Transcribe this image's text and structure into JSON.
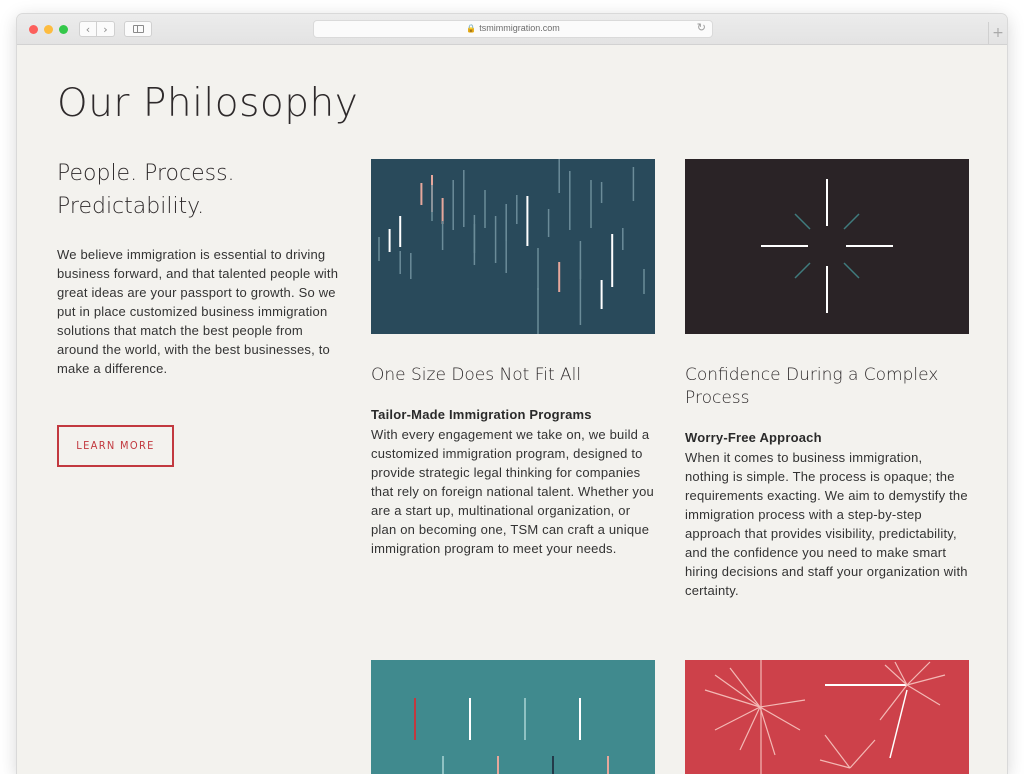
{
  "browser": {
    "url": "tsmimmigration.com",
    "back_icon": "chevron-left-icon",
    "forward_icon": "chevron-right-icon",
    "sidebar_icon": "sidebar-icon",
    "lock_icon": "lock-icon",
    "reload_icon": "reload-icon",
    "new_tab_icon": "plus-icon"
  },
  "page": {
    "title": "Our Philosophy",
    "tagline": "People. Process. Predictability.",
    "intro": "We believe immigration is essential to driving business forward, and that talented people with great ideas are your passport to growth. So we put in place customized business immigration solutions that match the best people from around the world, with the best businesses, to make a difference.",
    "learn_more": "LEARN MORE"
  },
  "cards": [
    {
      "heading": "One Size Does Not Fit All",
      "subheading": "Tailor-Made Immigration Programs",
      "body": "With every engagement we take on, we build a customized immigration program, designed to provide strategic legal thinking for companies that rely on foreign national talent. Whether you are a start up, multinational organization, or plan on becoming one, TSM can craft a unique immigration program to meet your needs."
    },
    {
      "heading": "Confidence During a Complex Process",
      "subheading": "Worry-Free Approach",
      "body": "When it comes to business immigration, nothing is simple. The process is opaque; the requirements exacting. We aim to demystify the immigration process with a step-by-step approach that provides visibility, predictability, and the confidence you need to make smart hiring decisions and staff your organization with certainty."
    }
  ],
  "colors": {
    "accent": "#c2393f",
    "background": "#f3f2ee",
    "card1_bg": "#294a5b",
    "card2_bg": "#2a2326",
    "card3_bg": "#408a8e",
    "card4_bg": "#cd414a"
  }
}
